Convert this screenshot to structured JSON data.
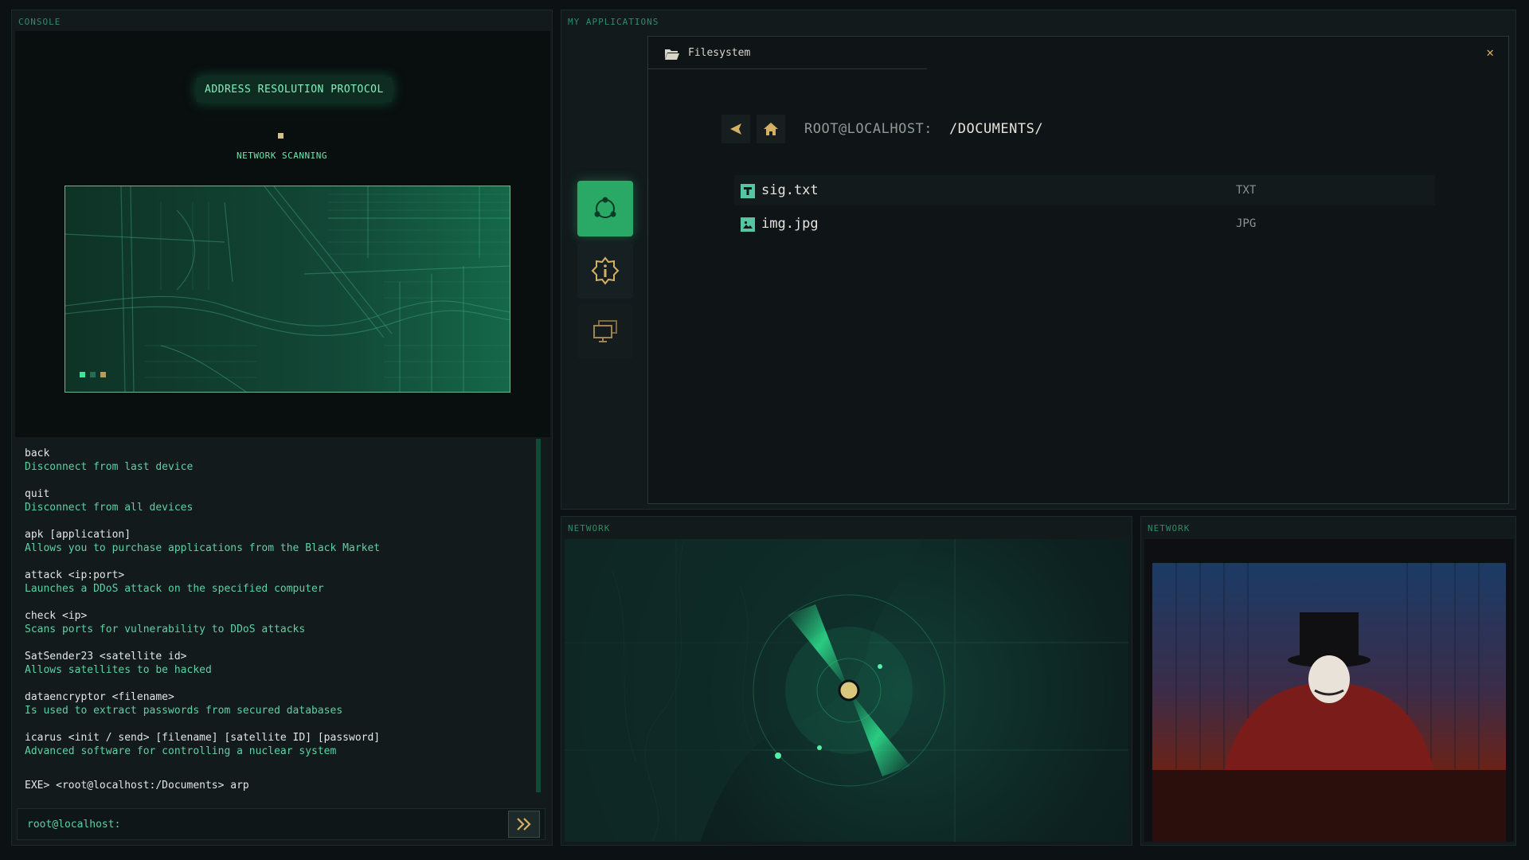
{
  "console": {
    "title": "CONSOLE",
    "arp": {
      "title": "ADDRESS RESOLUTION PROTOCOL",
      "status": "NETWORK SCANNING"
    },
    "commands": [
      {
        "name": "back",
        "desc": "Disconnect from last device"
      },
      {
        "name": "quit",
        "desc": "Disconnect from all devices"
      },
      {
        "name": "apk [application]",
        "desc": "Allows you to purchase applications from the Black Market"
      },
      {
        "name": "attack <ip:port>",
        "desc": "Launches a DDoS attack on the specified computer"
      },
      {
        "name": "check <ip>",
        "desc": "Scans ports for vulnerability to DDoS attacks"
      },
      {
        "name": "SatSender23 <satellite id>",
        "desc": "Allows satellites to be hacked"
      },
      {
        "name": "dataencryptor <filename>",
        "desc": "Is used to extract passwords from secured databases"
      },
      {
        "name": "icarus <init / send> [filename] [satellite ID] [password]",
        "desc": "Advanced software for controlling a nuclear system"
      }
    ],
    "exe_line": "EXE> <root@localhost:/Documents> arp",
    "prompt": "root@localhost:",
    "input_value": ""
  },
  "apps": {
    "title": "MY APPLICATIONS",
    "tiles": [
      {
        "icon": "network-nodes-icon",
        "active": true
      },
      {
        "icon": "info-badge-icon",
        "active": false
      },
      {
        "icon": "monitor-windows-icon",
        "active": false
      }
    ]
  },
  "filesystem": {
    "title": "Filesystem",
    "host": "ROOT@LOCALHOST:",
    "path": "/DOCUMENTS/",
    "files": [
      {
        "name": "sig.txt",
        "type": "TXT",
        "icon": "text-file-icon"
      },
      {
        "name": "img.jpg",
        "type": "JPG",
        "icon": "image-file-icon"
      }
    ]
  },
  "network_left": {
    "title": "NETWORK"
  },
  "network_right": {
    "title": "NETWORK"
  },
  "colors": {
    "accent": "#29a866",
    "text_green": "#5fd0a4",
    "gold": "#d4b062"
  }
}
